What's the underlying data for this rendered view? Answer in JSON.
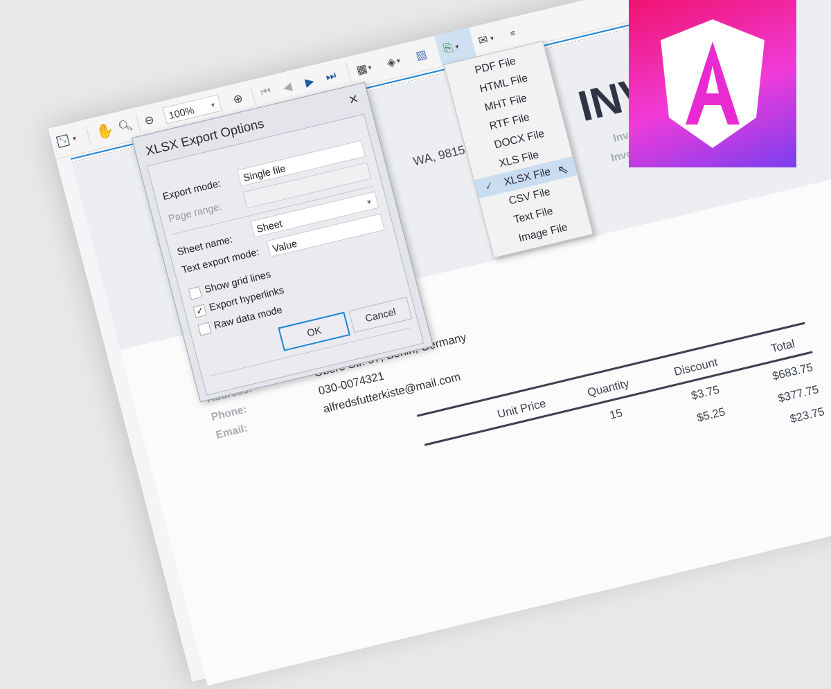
{
  "toolbar": {
    "zoom_value": "100%",
    "icons": [
      "fit-page-icon",
      "hand-tool-icon",
      "zoom-tool-icon",
      "zoom-out-icon",
      "zoom-in-icon",
      "first-page-icon",
      "previous-page-icon",
      "next-page-icon",
      "last-page-icon",
      "multipage-icon",
      "page-color-icon",
      "watermark-icon",
      "export-icon",
      "send-email-icon",
      "overflow-icon"
    ]
  },
  "export_menu": {
    "items": [
      {
        "label": "PDF File"
      },
      {
        "label": "HTML File"
      },
      {
        "label": "MHT File"
      },
      {
        "label": "RTF File"
      },
      {
        "label": "DOCX File"
      },
      {
        "label": "XLS File"
      },
      {
        "label": "XLSX File",
        "selected": true
      },
      {
        "label": "CSV File"
      },
      {
        "label": "Text File"
      },
      {
        "label": "Image File"
      }
    ],
    "check_mark": "✓"
  },
  "dialog": {
    "title": "XLSX Export Options",
    "close": "×",
    "export_mode_label": "Export mode:",
    "export_mode_value": "Single file",
    "page_range_label": "Page range:",
    "page_range_value": "",
    "sheet_name_label": "Sheet name:",
    "sheet_name_value": "Sheet",
    "text_export_mode_label": "Text export mode:",
    "text_export_mode_value": "Value",
    "show_grid_lines": {
      "label": "Show grid lines",
      "checked": false
    },
    "export_hyperlinks": {
      "label": "Export hyperlinks",
      "checked": true
    },
    "raw_data_mode": {
      "label": "Raw data mode",
      "checked": false
    },
    "ok": "OK",
    "cancel": "Cancel"
  },
  "invoice": {
    "title": "INVOICE",
    "invoice_no_label": "Invoice #",
    "invoice_date_label": "Invoice Date",
    "company_address_tail": "WA, 98156",
    "address_label": "Address:",
    "phone_label": "Phone:",
    "email_label": "Email:",
    "address": "Obere Str. 57, Berlin, Germany",
    "phone": "030-0074321",
    "email": "alfredsfutterkiste@mail.com",
    "columns": [
      "Unit Price",
      "Quantity",
      "Discount",
      "Total"
    ],
    "rows": [
      {
        "quantity": "15",
        "discount": "$3.75",
        "total": "$683.75"
      },
      {
        "quantity": "",
        "discount": "$5.25",
        "total": "$377.75"
      },
      {
        "quantity": "",
        "discount": "",
        "total": "$23.75"
      }
    ]
  },
  "colors": {
    "accent": "#1e88d8",
    "menu_selected": "#c9dcf0",
    "logo_start": "#f0136f",
    "logo_end": "#7a3ff0"
  }
}
